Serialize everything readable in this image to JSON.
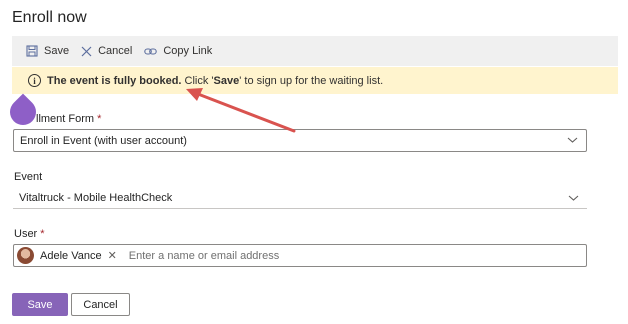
{
  "page": {
    "title": "Enroll now"
  },
  "toolbar": {
    "save_label": "Save",
    "cancel_label": "Cancel",
    "copy_link_label": "Copy Link"
  },
  "banner": {
    "bold_text": "The event is fully booked.",
    "text_before": " Click '",
    "save_word": "Save",
    "text_after": "' to sign up for the waiting list."
  },
  "fields": {
    "enrollment_form": {
      "label": "llment Form",
      "required_mark": "*",
      "value": "Enroll in Event (with user account)"
    },
    "event": {
      "label": "Event",
      "value": "Vitaltruck - Mobile HealthCheck"
    },
    "user": {
      "label": "User",
      "required_mark": "*",
      "selected_name": "Adele Vance",
      "remove_glyph": "✕",
      "placeholder": "Enter a name or email address"
    }
  },
  "footer": {
    "save_label": "Save",
    "cancel_label": "Cancel"
  },
  "colors": {
    "accent": "#8764b8",
    "banner_bg": "#fff4ce",
    "toolbar_bg": "#f0f0f0",
    "arrow": "#d9534f"
  },
  "icons": [
    "save-icon",
    "cancel-icon",
    "link-icon",
    "info-icon",
    "chevron-down-icon",
    "remove-icon"
  ]
}
